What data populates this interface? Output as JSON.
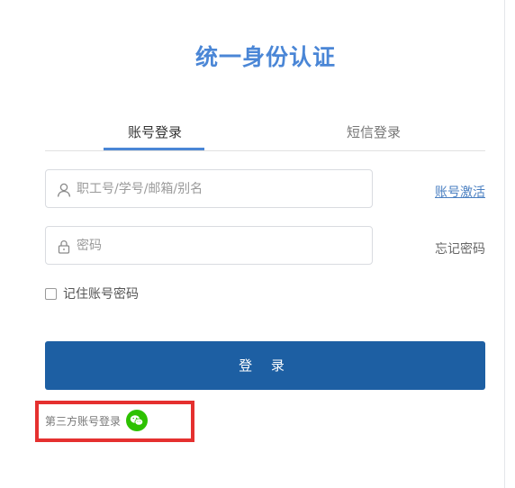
{
  "header": {
    "title": "统一身份认证"
  },
  "tabs": {
    "account_login": "账号登录",
    "sms_login": "短信登录",
    "active": "account_login"
  },
  "form": {
    "username_placeholder": "职工号/学号/邮箱/别名",
    "password_placeholder": "密码",
    "activate_link": "账号激活",
    "forgot_link": "忘记密码",
    "remember_label": "记住账号密码",
    "remember_checked": false,
    "login_button": "登 录"
  },
  "third_party": {
    "label": "第三方账号登录",
    "icons": [
      "wechat-icon"
    ]
  },
  "colors": {
    "title": "#4a86d6",
    "tab_underline": "#4a86d6",
    "login_button": "#1d5fa3",
    "wechat": "#2dc100",
    "highlight_box": "#e5302f"
  }
}
